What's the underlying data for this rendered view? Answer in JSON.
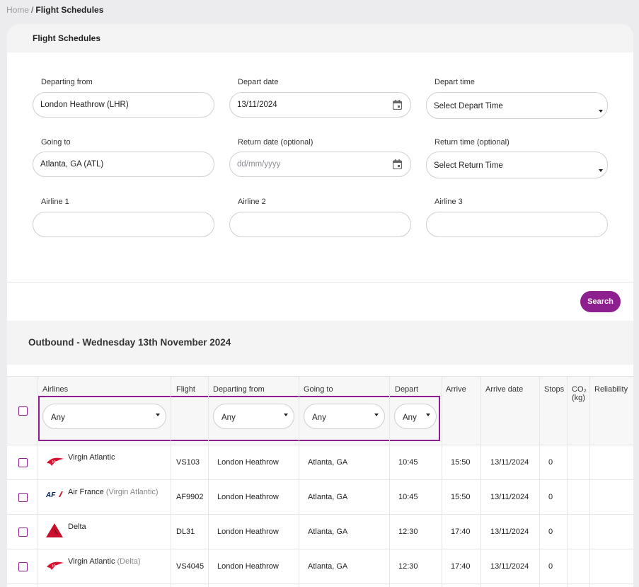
{
  "breadcrumb": {
    "home": "Home",
    "separator": "/",
    "current": "Flight Schedules"
  },
  "card": {
    "title": "Flight Schedules"
  },
  "form": {
    "departing_from": {
      "label": "Departing from",
      "value": "London Heathrow (LHR)"
    },
    "depart_date": {
      "label": "Depart date",
      "value": "13/11/2024"
    },
    "depart_time": {
      "label": "Depart time",
      "value": "Select Depart Time"
    },
    "going_to": {
      "label": "Going to",
      "value": "Atlanta, GA (ATL)"
    },
    "return_date": {
      "label": "Return date (optional)",
      "placeholder": "dd/mm/yyyy"
    },
    "return_time": {
      "label": "Return time (optional)",
      "value": "Select Return Time"
    },
    "airline1": {
      "label": "Airline 1",
      "value": ""
    },
    "airline2": {
      "label": "Airline 2",
      "value": ""
    },
    "airline3": {
      "label": "Airline 3",
      "value": ""
    },
    "search_label": "Search"
  },
  "outbound": {
    "title": "Outbound - Wednesday 13th November 2024"
  },
  "table": {
    "headers": {
      "airlines": "Airlines",
      "flight": "Flight",
      "departing_from": "Departing from",
      "going_to": "Going to",
      "depart": "Depart",
      "arrive": "Arrive",
      "arrive_date": "Arrive date",
      "stops": "Stops",
      "co2_line1": "CO₂",
      "co2_line2": "(kg)",
      "reliability": "Reliability"
    },
    "filters": {
      "airlines": "Any",
      "departing_from": "Any",
      "going_to": "Any",
      "depart": "Any"
    },
    "rows": [
      {
        "airline": "Virgin Atlantic",
        "operator": "",
        "logo": "virgin-atlantic-logo",
        "flight": "VS103",
        "from": "London Heathrow",
        "to": "Atlanta, GA",
        "depart": "10:45",
        "arrive": "15:50",
        "arrive_date": "13/11/2024",
        "stops": "0"
      },
      {
        "airline": "Air France",
        "operator": "(Virgin Atlantic)",
        "logo": "air-france-logo",
        "flight": "AF9902",
        "from": "London Heathrow",
        "to": "Atlanta, GA",
        "depart": "10:45",
        "arrive": "15:50",
        "arrive_date": "13/11/2024",
        "stops": "0"
      },
      {
        "airline": "Delta",
        "operator": "",
        "logo": "delta-logo",
        "flight": "DL31",
        "from": "London Heathrow",
        "to": "Atlanta, GA",
        "depart": "12:30",
        "arrive": "17:40",
        "arrive_date": "13/11/2024",
        "stops": "0"
      },
      {
        "airline": "Virgin Atlantic",
        "operator": "(Delta)",
        "logo": "virgin-atlantic-logo",
        "flight": "VS4045",
        "from": "London Heathrow",
        "to": "Atlanta, GA",
        "depart": "12:30",
        "arrive": "17:40",
        "arrive_date": "13/11/2024",
        "stops": "0"
      }
    ]
  },
  "colors": {
    "accent": "#8e1f8e",
    "virgin_red": "#d8112e",
    "delta_red": "#c8102e",
    "air_france_blue": "#002157"
  }
}
